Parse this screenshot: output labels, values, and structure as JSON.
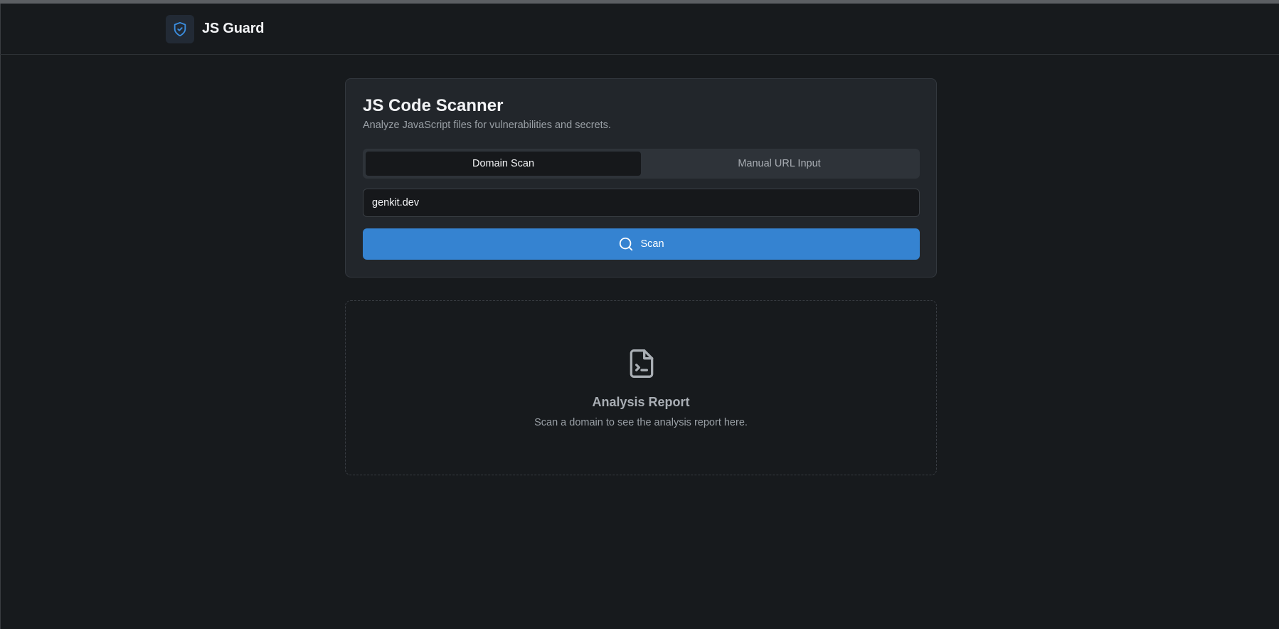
{
  "header": {
    "brand_icon": "shield-check-icon",
    "brand_title": "JS Guard"
  },
  "scanner": {
    "title": "JS Code Scanner",
    "subtitle": "Analyze JavaScript files for vulnerabilities and secrets.",
    "tabs": [
      {
        "label": "Domain Scan",
        "active": true
      },
      {
        "label": "Manual URL Input",
        "active": false
      }
    ],
    "domain_input": {
      "value": "genkit.dev"
    },
    "scan_button": {
      "label": "Scan",
      "icon": "search-icon"
    }
  },
  "report": {
    "icon": "file-terminal-icon",
    "title": "Analysis Report",
    "subtitle": "Scan a domain to see the analysis report here."
  },
  "colors": {
    "background": "#171a1d",
    "card": "#22262b",
    "accent": "#3583d1",
    "muted_text": "#9aa0a6"
  }
}
